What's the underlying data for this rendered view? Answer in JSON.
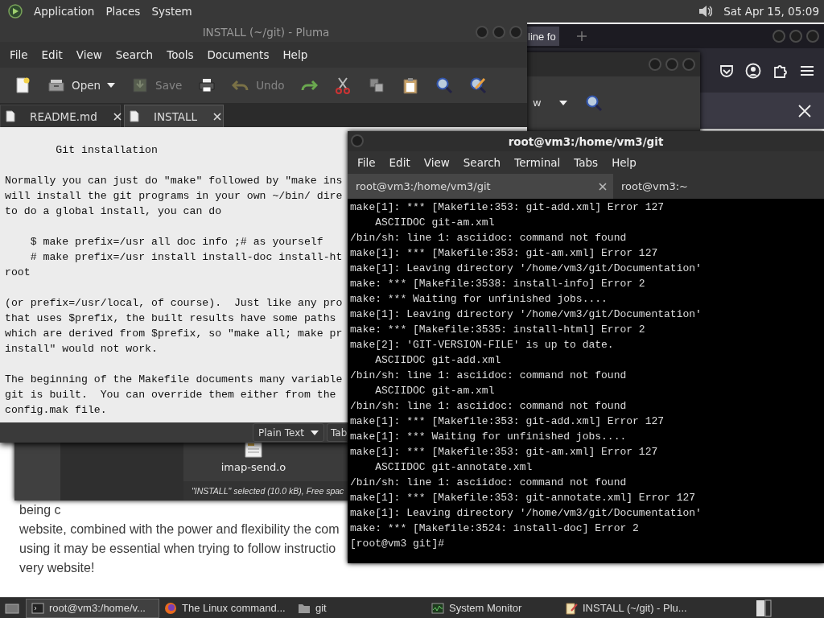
{
  "top_panel": {
    "menus": [
      "Application",
      "Places",
      "System"
    ],
    "clock": "Sat Apr 15, 05:09"
  },
  "browser": {
    "tab": "line fo",
    "page_text": [
      "being c",
      "website, combined with the power and flexibility the com",
      "using it may be essential when trying to follow instructio",
      "very website!"
    ]
  },
  "file_manager": {
    "toolbar_text": "w",
    "files": [
      "imap-send.o"
    ],
    "status": "\"INSTALL\" selected (10.0 kB), Free spac"
  },
  "editor": {
    "title": "INSTALL (~/git) - Pluma",
    "menu": [
      "File",
      "Edit",
      "View",
      "Search",
      "Tools",
      "Documents",
      "Help"
    ],
    "toolbar": [
      {
        "kind": "new",
        "disabled": false
      },
      {
        "kind": "open",
        "label": "Open",
        "disabled": false
      },
      {
        "kind": "save",
        "label": "Save",
        "disabled": true
      },
      {
        "kind": "print",
        "disabled": false
      },
      {
        "kind": "undo",
        "label": "Undo",
        "disabled": true
      },
      {
        "kind": "redo",
        "disabled": false
      },
      {
        "kind": "cut",
        "disabled": false
      },
      {
        "kind": "copy",
        "disabled": false
      },
      {
        "kind": "paste",
        "disabled": false
      },
      {
        "kind": "find",
        "disabled": false
      },
      {
        "kind": "replace",
        "disabled": false
      }
    ],
    "tabs": [
      {
        "label": "README.md",
        "selected": false
      },
      {
        "label": "INSTALL",
        "selected": true
      }
    ],
    "paragraphs": [
      [
        "        Git installation"
      ],
      [
        "Normally you can just do \"make\" followed by \"make ins",
        "will install the git programs in your own ~/bin/ dire",
        "to do a global install, you can do"
      ],
      [
        "    $ make prefix=/usr all doc info ;# as yourself",
        "    # make prefix=/usr install install-doc install-ht",
        "root"
      ],
      [
        "(or prefix=/usr/local, of course).  Just like any pro",
        "that uses $prefix, the built results have some paths",
        "which are derived from $prefix, so \"make all; make pr",
        "install\" would not work."
      ],
      [
        "The beginning of the Makefile documents many variable",
        "git is built.  You can override them either from the",
        "config.mak file."
      ]
    ],
    "status_bar": {
      "language": "Plain Text",
      "tab_width": "Tab"
    }
  },
  "terminal": {
    "title": "root@vm3:/home/vm3/git",
    "menu": [
      "File",
      "Edit",
      "View",
      "Search",
      "Terminal",
      "Tabs",
      "Help"
    ],
    "tabs": [
      {
        "label": "root@vm3:/home/vm3/git",
        "selected": true
      },
      {
        "label": "root@vm3:~",
        "selected": false
      }
    ],
    "lines": [
      "make[1]: *** [Makefile:353: git-add.xml] Error 127",
      "    ASCIIDOC git-am.xml",
      "/bin/sh: line 1: asciidoc: command not found",
      "make[1]: *** [Makefile:353: git-am.xml] Error 127",
      "make[1]: Leaving directory '/home/vm3/git/Documentation'",
      "make: *** [Makefile:3538: install-info] Error 2",
      "make: *** Waiting for unfinished jobs....",
      "make[1]: Leaving directory '/home/vm3/git/Documentation'",
      "make: *** [Makefile:3535: install-html] Error 2",
      "make[2]: 'GIT-VERSION-FILE' is up to date.",
      "    ASCIIDOC git-add.xml",
      "/bin/sh: line 1: asciidoc: command not found",
      "    ASCIIDOC git-am.xml",
      "/bin/sh: line 1: asciidoc: command not found",
      "make[1]: *** [Makefile:353: git-add.xml] Error 127",
      "make[1]: *** Waiting for unfinished jobs....",
      "make[1]: *** [Makefile:353: git-am.xml] Error 127",
      "    ASCIIDOC git-annotate.xml",
      "/bin/sh: line 1: asciidoc: command not found",
      "make[1]: *** [Makefile:353: git-annotate.xml] Error 127",
      "make[1]: Leaving directory '/home/vm3/git/Documentation'",
      "make: *** [Makefile:3524: install-doc] Error 2",
      "[root@vm3 git]#"
    ]
  },
  "taskbar": [
    {
      "kind": "terminal",
      "label": "root@vm3:/home/v...",
      "selected": true
    },
    {
      "kind": "browser",
      "label": "The Linux command...",
      "selected": false
    },
    {
      "kind": "folder",
      "label": "git",
      "selected": false
    },
    {
      "kind": "monitor",
      "label": "System Monitor",
      "selected": false
    },
    {
      "kind": "editor",
      "label": "INSTALL (~/git) - Plu...",
      "selected": false
    }
  ]
}
